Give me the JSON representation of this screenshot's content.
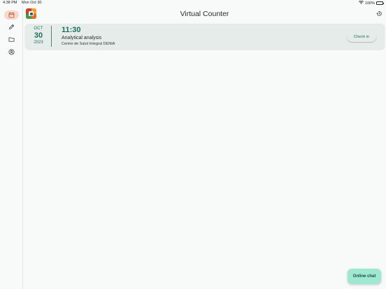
{
  "status_bar": {
    "time": "4:38 PM",
    "date": "Mon Oct 30",
    "battery": "100%",
    "wifi_icon": "wifi-icon",
    "battery_icon": "battery-icon"
  },
  "sidebar": {
    "items": [
      {
        "name": "appointments",
        "icon": "calendar-icon",
        "active": true
      },
      {
        "name": "edit",
        "icon": "pencil-icon",
        "active": false
      },
      {
        "name": "documents",
        "icon": "folder-icon",
        "active": false
      },
      {
        "name": "profile",
        "icon": "user-circle-icon",
        "active": false
      }
    ]
  },
  "header": {
    "title": "Virtual Counter",
    "history_icon": "history-icon"
  },
  "appointment": {
    "month": "OCT",
    "day": "30",
    "year": "2023",
    "time": "11:30",
    "title": "Analytical analysis",
    "location": "Centre de Salut Integral DENIA",
    "checkin_label": "Check in"
  },
  "chat": {
    "label": "Online chat"
  },
  "colors": {
    "accent": "#1d6e5e",
    "active_nav": "#f5d9cf",
    "card": "#e6ece9",
    "chat_button": "#9ee7d0",
    "background": "#f8faf9"
  }
}
